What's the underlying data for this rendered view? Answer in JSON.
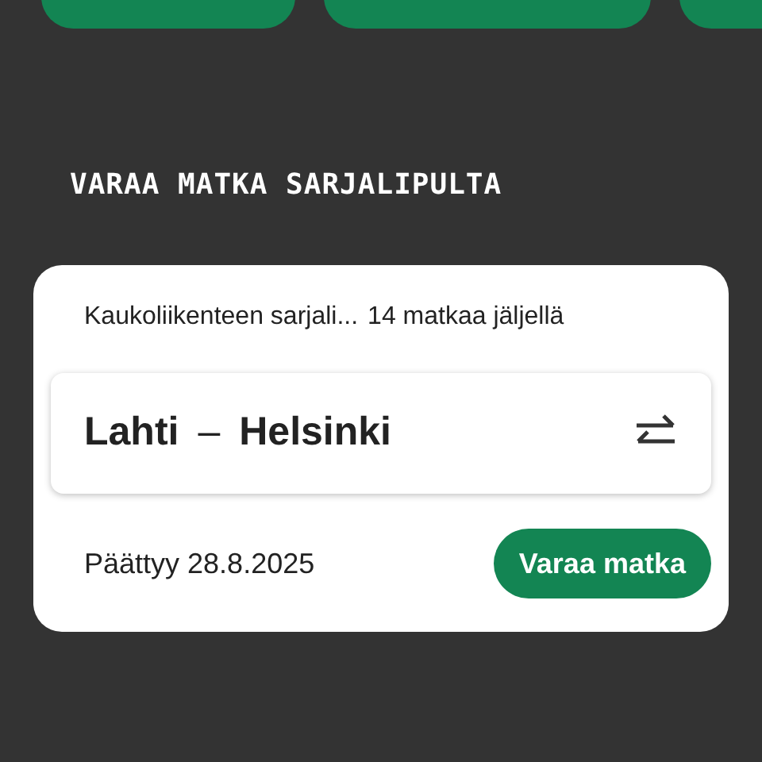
{
  "section_title": "VARAA MATKA SARJALIPULTA",
  "ticket_card": {
    "ticket_name": "Kaukoliikenteen sarjali...",
    "trips_left": "14 matkaa jäljellä",
    "route": {
      "from": "Lahti",
      "separator": "–",
      "to": "Helsinki"
    },
    "expires": "Päättyy 28.8.2025",
    "book_button": "Varaa matka"
  }
}
